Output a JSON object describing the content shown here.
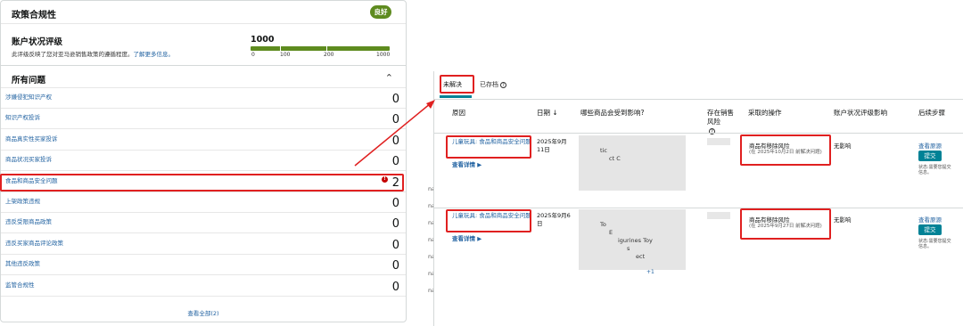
{
  "left": {
    "title": "政策合规性",
    "badge": "良好",
    "account": {
      "title": "账户状况评级",
      "desc": "此评级反映了您对亚马逊销售政策的遵循程度。",
      "link": "了解更多信息。",
      "score": "1000",
      "ticks": [
        "0",
        "100",
        "200",
        "1000"
      ]
    },
    "issues_title": "所有问题",
    "issues": [
      {
        "name": "涉嫌侵犯知识产权",
        "count": "0"
      },
      {
        "name": "知识产权投诉",
        "count": "0"
      },
      {
        "name": "商品真实性买家投诉",
        "count": "0"
      },
      {
        "name": "商品状况买家投诉",
        "count": "0"
      },
      {
        "name": "食品和商品安全问题",
        "count": "2",
        "alert": "!"
      },
      {
        "name": "上架政策违规",
        "count": "0"
      },
      {
        "name": "违反受限商品政策",
        "count": "0"
      },
      {
        "name": "违反买家商品评论政策",
        "count": "0"
      },
      {
        "name": "其他违反政策",
        "count": "0"
      },
      {
        "name": "监管合规性",
        "count": "0"
      }
    ],
    "view_all": "查看全部(2)"
  },
  "right": {
    "tabs": {
      "unresolved": "未解决",
      "archived": "已存档"
    },
    "headers": {
      "reason": "原因",
      "date": "日期 ↓",
      "affected": "哪些商品会受到影响?",
      "at_risk": "存在销售风险",
      "action": "采取的操作",
      "impact": "账户状况评级影响",
      "next": "后续步骤"
    },
    "rows": [
      {
        "reason": "儿童玩具: 食品和商品安全问题",
        "detail": "查看详情 ▶",
        "date": "2025年9月11日",
        "product_snippets": [
          "tic",
          "ct C"
        ],
        "action_title": "商品有移除风险",
        "action_sub": "(在 2025年10月2日 前解决问题)",
        "impact": "无影响",
        "view_source": "查看原源",
        "submit": "提交",
        "status": "状态:需要您提交信息。"
      },
      {
        "reason": "儿童玩具: 食品和商品安全问题",
        "detail": "查看详情 ▶",
        "date": "2025年9月6日",
        "product_snippets": [
          "To",
          "E",
          "igurines Toy",
          "s",
          "ect"
        ],
        "more": "+1",
        "action_title": "商品有移除风险",
        "action_sub": "(在 2025年9月27日 前解决问题)",
        "impact": "无影响",
        "view_source": "查看原源",
        "submit": "提交",
        "status": "状态:需要您提交信息。"
      }
    ],
    "fragments": [
      "na",
      "na",
      "na",
      "na",
      "na",
      "na",
      "na"
    ]
  },
  "colors": {
    "accent": "#008296",
    "good": "#5e8b1f",
    "highlight": "#e02020",
    "link": "#2162a1"
  }
}
